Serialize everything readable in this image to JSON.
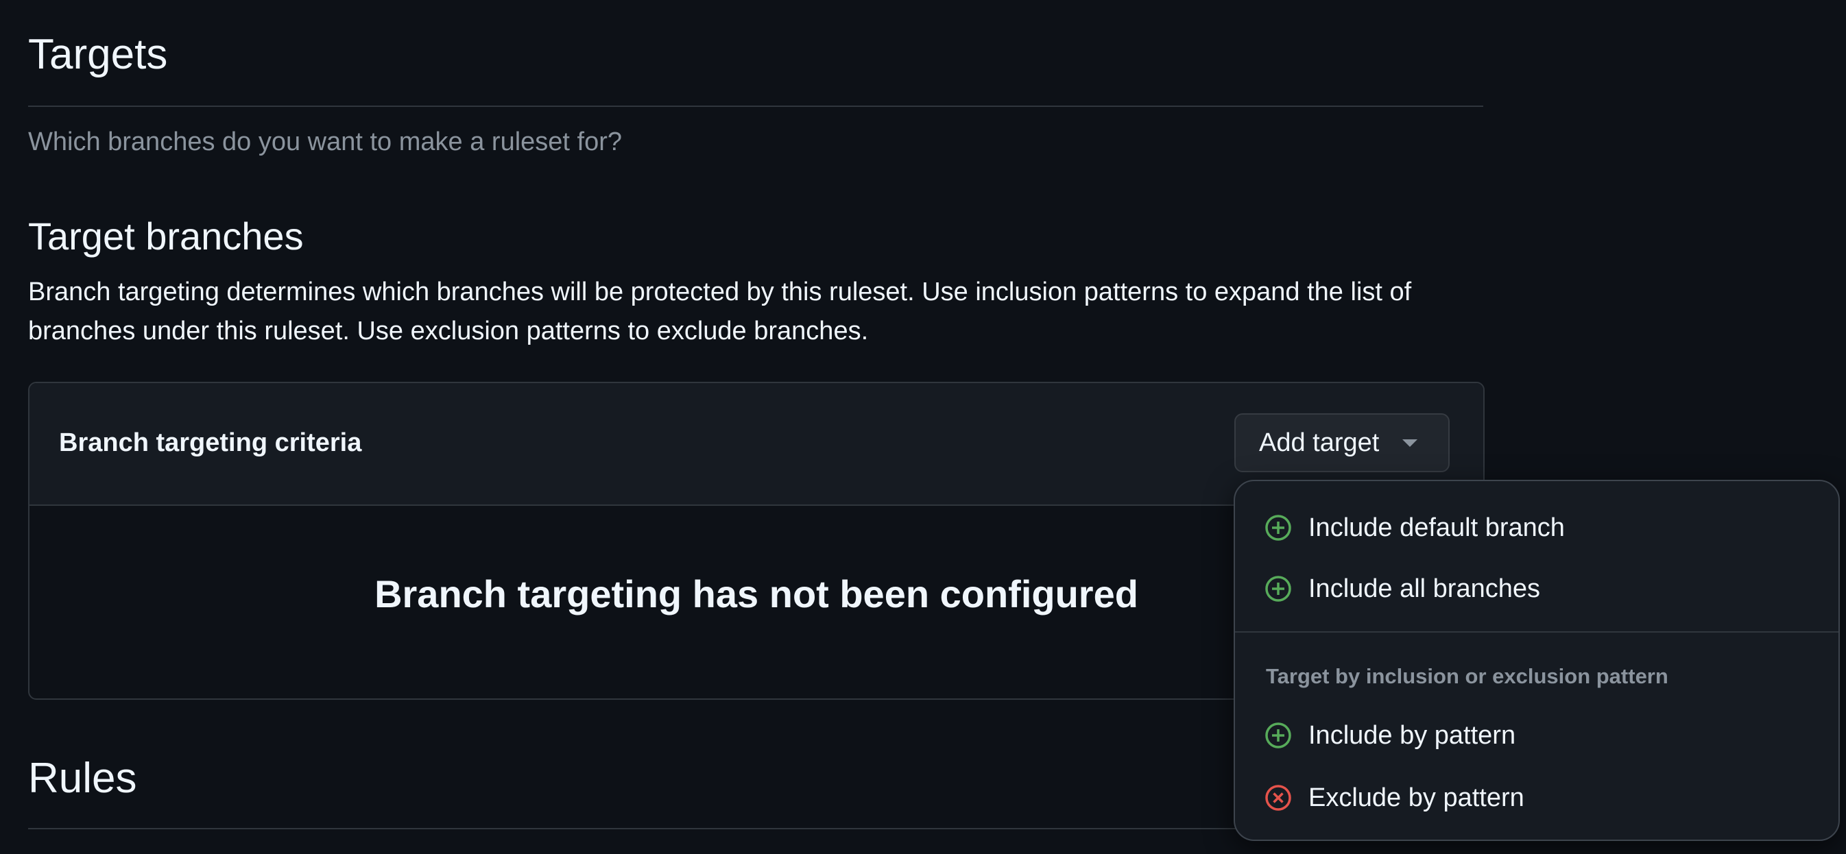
{
  "targets": {
    "title": "Targets",
    "subtitle": "Which branches do you want to make a ruleset for?"
  },
  "target_branches": {
    "title": "Target branches",
    "description": "Branch targeting determines which branches will be protected by this ruleset. Use inclusion patterns to expand the list of branches under this ruleset. Use exclusion patterns to exclude branches.",
    "criteria_label": "Branch targeting criteria",
    "empty_state": "Branch targeting has not been configured",
    "add_target_label": "Add target"
  },
  "menu": {
    "items": [
      {
        "label": "Include default branch",
        "icon": "plus-circle-icon"
      },
      {
        "label": "Include all branches",
        "icon": "plus-circle-icon"
      }
    ],
    "group_label": "Target by inclusion or exclusion pattern",
    "pattern_items": [
      {
        "label": "Include by pattern",
        "icon": "plus-circle-icon"
      },
      {
        "label": "Exclude by pattern",
        "icon": "x-circle-icon"
      }
    ]
  },
  "rules": {
    "title": "Rules"
  },
  "colors": {
    "include": "#57ab5a",
    "exclude": "#e5534b",
    "background": "#0d1117"
  }
}
